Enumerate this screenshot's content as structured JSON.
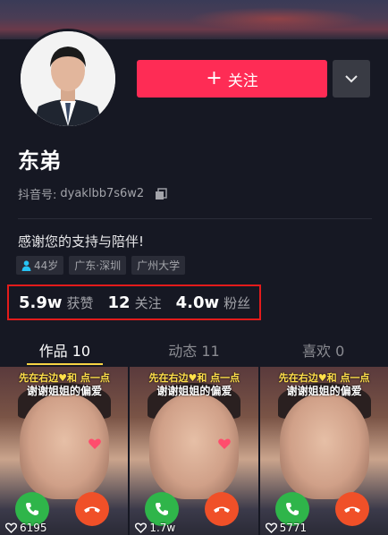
{
  "profile": {
    "follow_label": "关注",
    "name": "东弟",
    "douyin_id_label": "抖音号:",
    "douyin_id": "dyaklbb7s6w2",
    "bio": "感谢您的支持与陪伴!",
    "tags": [
      "44岁",
      "广东·深圳",
      "广州大学"
    ]
  },
  "stats": [
    {
      "value": "5.9w",
      "label": "获赞"
    },
    {
      "value": "12",
      "label": "关注"
    },
    {
      "value": "4.0w",
      "label": "粉丝"
    }
  ],
  "tabs": [
    {
      "label": "作品 10",
      "active": true
    },
    {
      "label": "动态 11",
      "active": false
    },
    {
      "label": "喜欢 0",
      "active": false
    }
  ],
  "videos": [
    {
      "caption_top": "先在右边♥和   点一点",
      "caption_bottom": "谢谢姐姐的偏爱",
      "likes": "6195"
    },
    {
      "caption_top": "先在右边♥和   点一点",
      "caption_bottom": "谢谢姐姐的偏爱",
      "likes": "1.7w"
    },
    {
      "caption_top": "先在右边♥和   点一点",
      "caption_bottom": "谢谢姐姐的偏爱",
      "likes": "5771"
    }
  ],
  "colors": {
    "accent": "#fe2c55",
    "highlight_box": "#e31b1b",
    "tab_indicator": "#f7d344"
  },
  "icons": {
    "more": "chevron-down-icon",
    "copy": "copy-icon",
    "gender": "person-icon",
    "likes": "heart-outline-icon"
  }
}
